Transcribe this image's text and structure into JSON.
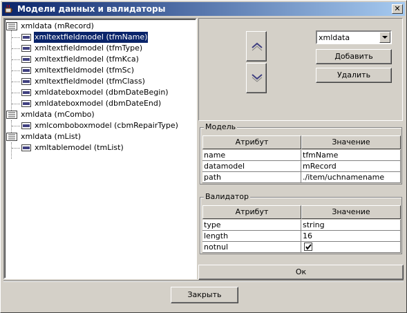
{
  "window": {
    "title": "Модели данных и валидаторы",
    "close_symbol": "✕"
  },
  "tree": {
    "nodes": [
      {
        "label": "xmldata (mRecord)",
        "type": "folder",
        "level": 0
      },
      {
        "label": "xmltextfieldmodel (tfmName)",
        "type": "leaf",
        "level": 1,
        "selected": true
      },
      {
        "label": "xmltextfieldmodel (tfmType)",
        "type": "leaf",
        "level": 1
      },
      {
        "label": "xmltextfieldmodel (tfmKca)",
        "type": "leaf",
        "level": 1
      },
      {
        "label": "xmltextfieldmodel (tfmSc)",
        "type": "leaf",
        "level": 1
      },
      {
        "label": "xmltextfieldmodel (tfmClass)",
        "type": "leaf",
        "level": 1
      },
      {
        "label": "xmldateboxmodel (dbmDateBegin)",
        "type": "leaf",
        "level": 1
      },
      {
        "label": "xmldateboxmodel (dbmDateEnd)",
        "type": "leaf",
        "level": 1
      },
      {
        "label": "xmldata (mCombo)",
        "type": "folder",
        "level": 0
      },
      {
        "label": "xmlcomboboxmodel (cbmRepairType)",
        "type": "leaf",
        "level": 1
      },
      {
        "label": "xmldata (mList)",
        "type": "folder",
        "level": 0
      },
      {
        "label": "xmltablemodel (tmList)",
        "type": "leaf",
        "level": 1
      }
    ]
  },
  "controls": {
    "combo_value": "xmldata",
    "add_label": "Добавить",
    "delete_label": "Удалить",
    "up_icon": "chevron-up-icon",
    "down_icon": "chevron-down-icon"
  },
  "model_group": {
    "title": "Модель",
    "col_attr": "Атрибут",
    "col_value": "Значение",
    "rows": [
      {
        "attr": "name",
        "value": "tfmName"
      },
      {
        "attr": "datamodel",
        "value": "mRecord"
      },
      {
        "attr": "path",
        "value": "./item/uchnamename"
      }
    ]
  },
  "validator_group": {
    "title": "Валидатор",
    "col_attr": "Атрибут",
    "col_value": "Значение",
    "rows": [
      {
        "attr": "type",
        "value": "string"
      },
      {
        "attr": "length",
        "value": "16"
      },
      {
        "attr": "notnul",
        "value": "",
        "checked": true
      }
    ]
  },
  "ok_label": "Ок",
  "close_label": "Закрыть",
  "colors": {
    "titlebar_start": "#0a246a",
    "titlebar_end": "#a6caf0",
    "face": "#d4d0c8",
    "selection": "#0a246a"
  }
}
